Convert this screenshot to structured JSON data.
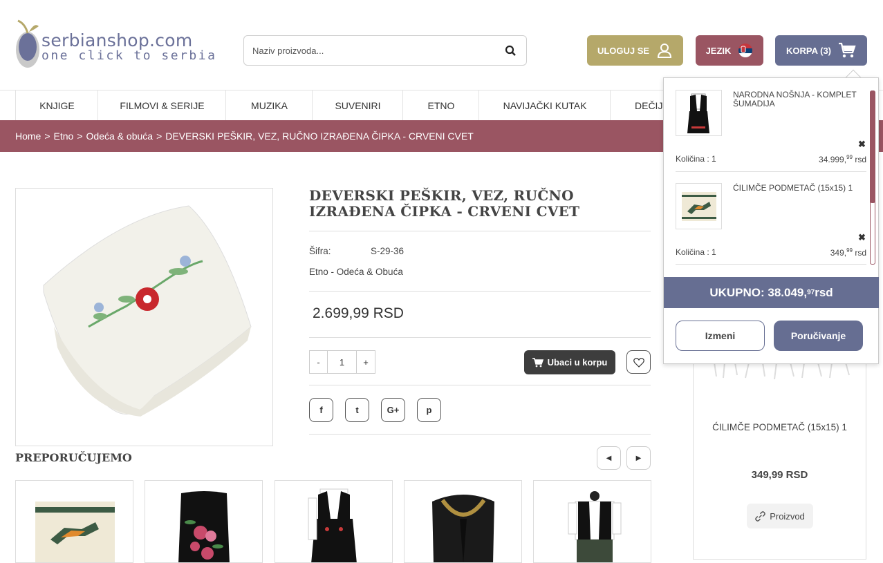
{
  "header": {
    "logo_line1": "serbianshop.com",
    "logo_line2": "one click to serbia",
    "search_placeholder": "Naziv proizvoda...",
    "login_label": "ULOGUJ SE",
    "language_label": "JEZIK",
    "cart_label": "KORPA (3)"
  },
  "nav": {
    "items": [
      "KNJIGE",
      "FILMOVI & SERIJE",
      "MUZIKA",
      "SUVENIRI",
      "ETNO",
      "NAVIJAČKI KUTAK",
      "DEČIJ"
    ]
  },
  "breadcrumb": {
    "items": [
      "Home",
      "Etno",
      "Odeća & obuća",
      "DEVERSKI PEŠKIR, VEZ, RUČNO IZRAĐENA ČIPKA - CRVENI CVET"
    ],
    "separator": ">"
  },
  "product": {
    "title": "DEVERSKI PEŠKIR, VEZ, RUČNO IZRAĐENA ČIPKA - CRVENI CVET",
    "sku_label": "Šifra:",
    "sku_value": "S-29-36",
    "category": "Etno - Odeća & Obuća",
    "price": "2.699,99 RSD",
    "qty_minus": "-",
    "qty_value": "1",
    "qty_plus": "+",
    "add_to_cart": "Ubaci u korpu"
  },
  "social": [
    "f",
    "t",
    "G+",
    "p"
  ],
  "recommended": {
    "title": "PREPORUČUJEMO"
  },
  "side_product": {
    "name": "ĆILIMČE PODMETAČ (15x15) 1",
    "price": "349,99 RSD",
    "button": "Proizvod"
  },
  "cart_popup": {
    "items": [
      {
        "name": "NARODNA NOŠNJA - KOMPLET ŠUMADIJA",
        "qty_label": "Količina : 1",
        "price_main": "34.999,",
        "price_sup": "99",
        "price_unit": " rsd"
      },
      {
        "name": "ĆILIMČE PODMETAČ (15x15) 1",
        "qty_label": "Količina : 1",
        "price_main": "349,",
        "price_sup": "99",
        "price_unit": " rsd"
      }
    ],
    "total_main": "UKUPNO: 38.049,",
    "total_sup": "97",
    "total_unit": " rsd",
    "edit_label": "Izmeni",
    "order_label": "Poručivanje"
  },
  "colors": {
    "brand_plum": "#9a5562",
    "brand_slate": "#666e92",
    "brand_olive": "#b5a86a"
  }
}
